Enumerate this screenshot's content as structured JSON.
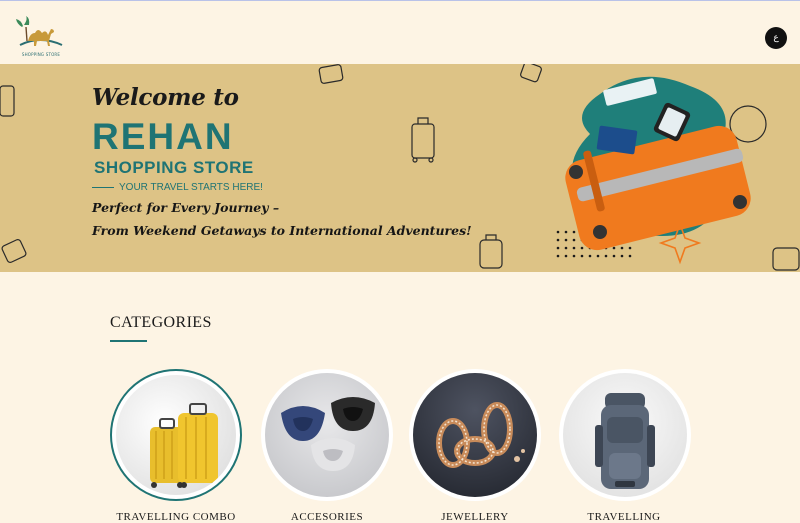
{
  "header": {
    "logo_text": "SHOPPING STORE",
    "lang_button": "ع"
  },
  "hero": {
    "welcome": "Welcome to",
    "brand": "REHAN",
    "store": "SHOPPING STORE",
    "tagline": "YOUR TRAVEL STARTS HERE!",
    "line1": "Perfect for Every Journey –",
    "line2": "From Weekend Getaways to International Adventures!"
  },
  "categories": {
    "title": "CATEGORIES",
    "items": [
      {
        "label": "TRAVELLING COMBO",
        "icon": "luggage-set-image"
      },
      {
        "label": "ACCESORIES",
        "icon": "neck-pillow-image"
      },
      {
        "label": "JEWELLERY",
        "icon": "bangles-image"
      },
      {
        "label": "TRAVELLING",
        "icon": "backpack-image"
      }
    ]
  },
  "colors": {
    "accent": "#1f7474",
    "hero_bg": "#ddc386",
    "page_bg": "#fdf4e4",
    "suitcase": "#f07a1e"
  }
}
